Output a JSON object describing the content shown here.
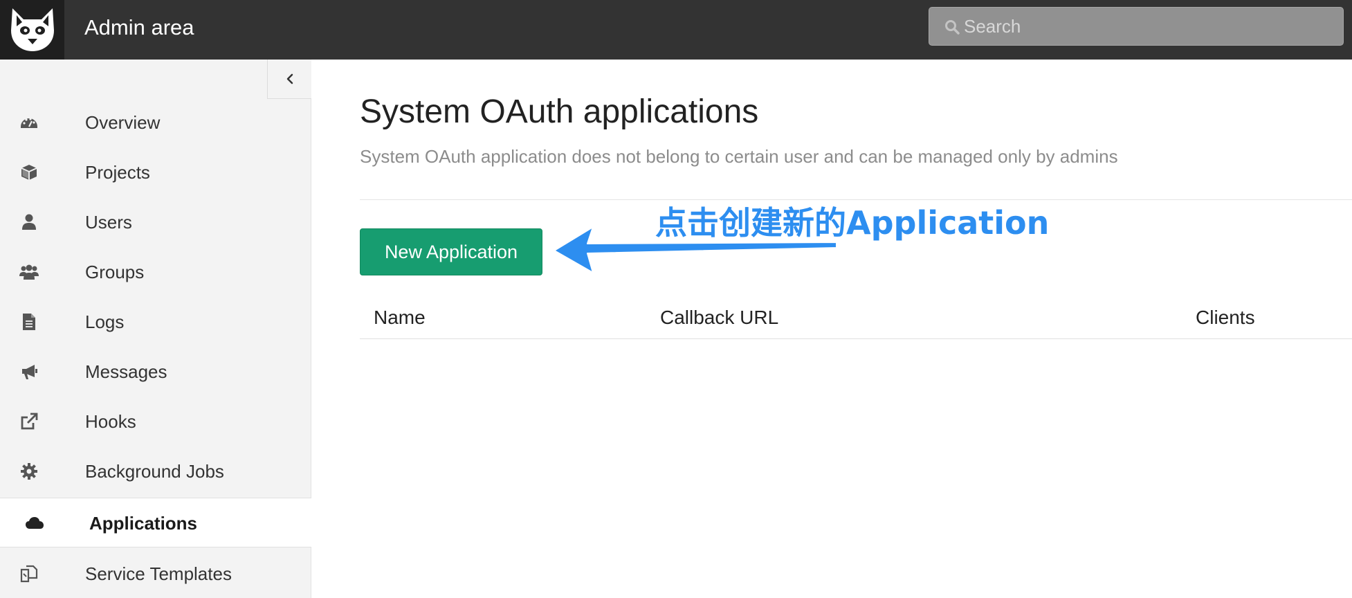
{
  "header": {
    "title": "Admin area",
    "search_placeholder": "Search"
  },
  "sidebar": {
    "items": [
      {
        "label": "Overview",
        "icon": "dashboard-icon"
      },
      {
        "label": "Projects",
        "icon": "cube-icon"
      },
      {
        "label": "Users",
        "icon": "user-icon"
      },
      {
        "label": "Groups",
        "icon": "users-icon"
      },
      {
        "label": "Logs",
        "icon": "file-text-icon"
      },
      {
        "label": "Messages",
        "icon": "bullhorn-icon"
      },
      {
        "label": "Hooks",
        "icon": "external-link-icon"
      },
      {
        "label": "Background Jobs",
        "icon": "gear-icon"
      },
      {
        "label": "Applications",
        "icon": "cloud-icon",
        "active": true
      },
      {
        "label": "Service Templates",
        "icon": "copy-icon"
      }
    ]
  },
  "main": {
    "title": "System OAuth applications",
    "description": "System OAuth application does not belong to certain user and can be managed only by admins",
    "new_button_label": "New Application",
    "annotation": "点击创建新的Application",
    "table": {
      "columns": [
        "Name",
        "Callback URL",
        "Clients"
      ]
    }
  },
  "colors": {
    "header_bg": "#333333",
    "sidebar_bg": "#f3f3f3",
    "button_green": "#179d70",
    "annotation_blue": "#2d8ef0"
  }
}
